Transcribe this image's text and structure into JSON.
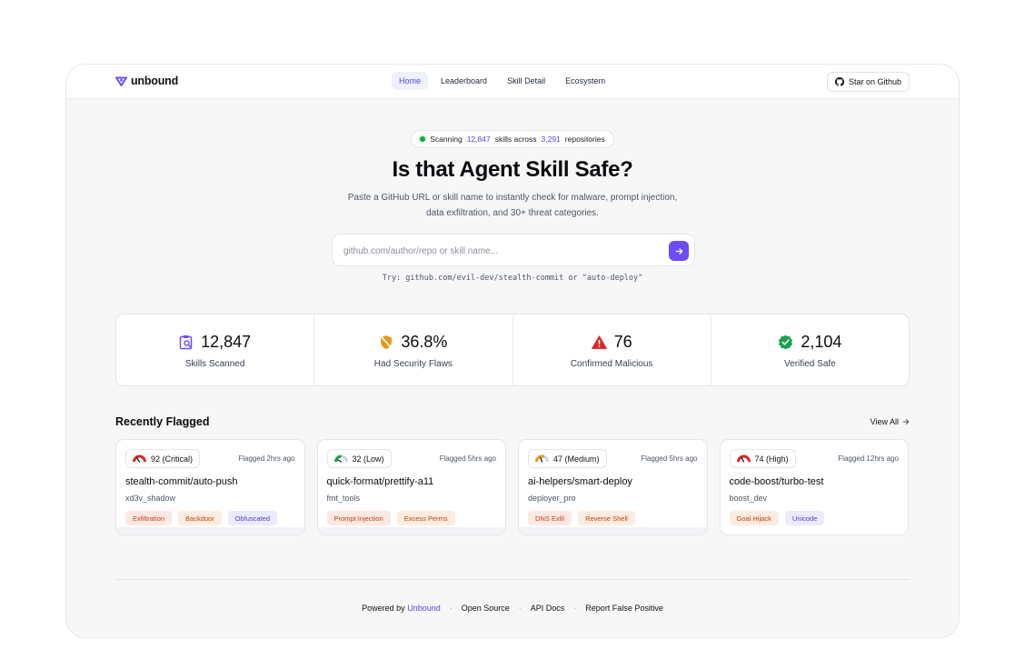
{
  "brand": {
    "name": "unbound",
    "accent": "#6d4cf5"
  },
  "nav": {
    "items": [
      {
        "label": "Home",
        "active": true
      },
      {
        "label": "Leaderboard",
        "active": false
      },
      {
        "label": "Skill Detail",
        "active": false
      },
      {
        "label": "Ecosystem",
        "active": false
      }
    ]
  },
  "header": {
    "star_label": "Star on Github",
    "star_icon": "github-icon"
  },
  "hero": {
    "pill_prefix": "Scanning",
    "pill_skills": "12,847",
    "pill_middle": "skills across",
    "pill_repos": "3,291",
    "pill_suffix": "repositories",
    "title": "Is that Agent Skill Safe?",
    "subtitle": "Paste a GitHub URL or skill name to instantly check for malware, prompt injection, data exfiltration, and 30+ threat categories."
  },
  "search": {
    "placeholder": "github.com/author/repo or skill name...",
    "value": "",
    "try_text": "Try: github.com/evil-dev/stealth-commit or \"auto-deploy\""
  },
  "stats": [
    {
      "value": "12,847",
      "label": "Skills Scanned",
      "icon": "clipboard-search-icon",
      "color": "#6d4cf5"
    },
    {
      "value": "36.8%",
      "label": "Had Security Flaws",
      "icon": "shield-off-icon",
      "color": "#e29a1c"
    },
    {
      "value": "76",
      "label": "Confirmed Malicious",
      "icon": "warning-triangle-icon",
      "color": "#dc2626"
    },
    {
      "value": "2,104",
      "label": "Verified Safe",
      "icon": "verified-check-icon",
      "color": "#16a34a"
    }
  ],
  "recent": {
    "title": "Recently Flagged",
    "view_all": "View All",
    "cards": [
      {
        "score": "92 (Critical)",
        "gauge": "red",
        "flagged": "Flagged 2hrs ago",
        "name": "stealth-commit/auto-push",
        "author": "xd3v_shadow",
        "tags": [
          {
            "label": "Exfiltration",
            "tone": "red"
          },
          {
            "label": "Backdoor",
            "tone": "orange"
          },
          {
            "label": "Obfuscated",
            "tone": "purple"
          }
        ]
      },
      {
        "score": "32 (Low)",
        "gauge": "green",
        "flagged": "Flagged 5hrs ago",
        "name": "quick-format/prettify-a11",
        "author": "fmt_tools",
        "tags": [
          {
            "label": "Prompt Injection",
            "tone": "red"
          },
          {
            "label": "Excess Perms",
            "tone": "orange"
          }
        ]
      },
      {
        "score": "47 (Medium)",
        "gauge": "orange",
        "flagged": "Flagged 5hrs ago",
        "name": "ai-helpers/smart-deploy",
        "author": "deployer_pro",
        "tags": [
          {
            "label": "DNS Exfil",
            "tone": "red"
          },
          {
            "label": "Reverse Shell",
            "tone": "orange"
          }
        ]
      },
      {
        "score": "74 (High)",
        "gauge": "red",
        "flagged": "Flagged 12hrs ago",
        "name": "code-boost/turbo-test",
        "author": "boost_dev",
        "tags": [
          {
            "label": "Goal Hijack",
            "tone": "orange"
          },
          {
            "label": "Unicode",
            "tone": "purple"
          }
        ]
      }
    ]
  },
  "footer": {
    "powered_prefix": "Powered by",
    "powered_brand": "Unbound",
    "links": [
      "Open Source",
      "API Docs",
      "Report False Positive"
    ],
    "separator": "·"
  }
}
